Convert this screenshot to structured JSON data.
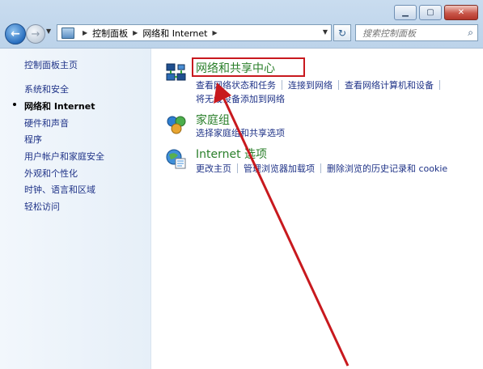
{
  "address_bar": {
    "crumbs": [
      "控制面板",
      "网络和 Internet"
    ]
  },
  "search": {
    "placeholder": "搜索控制面板"
  },
  "sidebar": {
    "home": "控制面板主页",
    "items": [
      {
        "label": "系统和安全",
        "active": false
      },
      {
        "label": "网络和 Internet",
        "active": true
      },
      {
        "label": "硬件和声音",
        "active": false
      },
      {
        "label": "程序",
        "active": false
      },
      {
        "label": "用户帐户和家庭安全",
        "active": false
      },
      {
        "label": "外观和个性化",
        "active": false
      },
      {
        "label": "时钟、语言和区域",
        "active": false
      },
      {
        "label": "轻松访问",
        "active": false
      }
    ]
  },
  "categories": [
    {
      "title": "网络和共享中心",
      "icon": "network-icon",
      "links": [
        "查看网络状态和任务",
        "连接到网络",
        "查看网络计算机和设备"
      ],
      "links2": [
        "将无线设备添加到网络"
      ]
    },
    {
      "title": "家庭组",
      "icon": "homegroup-icon",
      "links": [
        "选择家庭组和共享选项"
      ]
    },
    {
      "title": "Internet 选项",
      "icon": "internet-options-icon",
      "links": [
        "更改主页",
        "管理浏览器加载项",
        "删除浏览的历史记录和 cookie"
      ]
    }
  ],
  "colors": {
    "link": "#1e3287",
    "category_title": "#2a7f2a",
    "highlight": "#c8191e"
  }
}
